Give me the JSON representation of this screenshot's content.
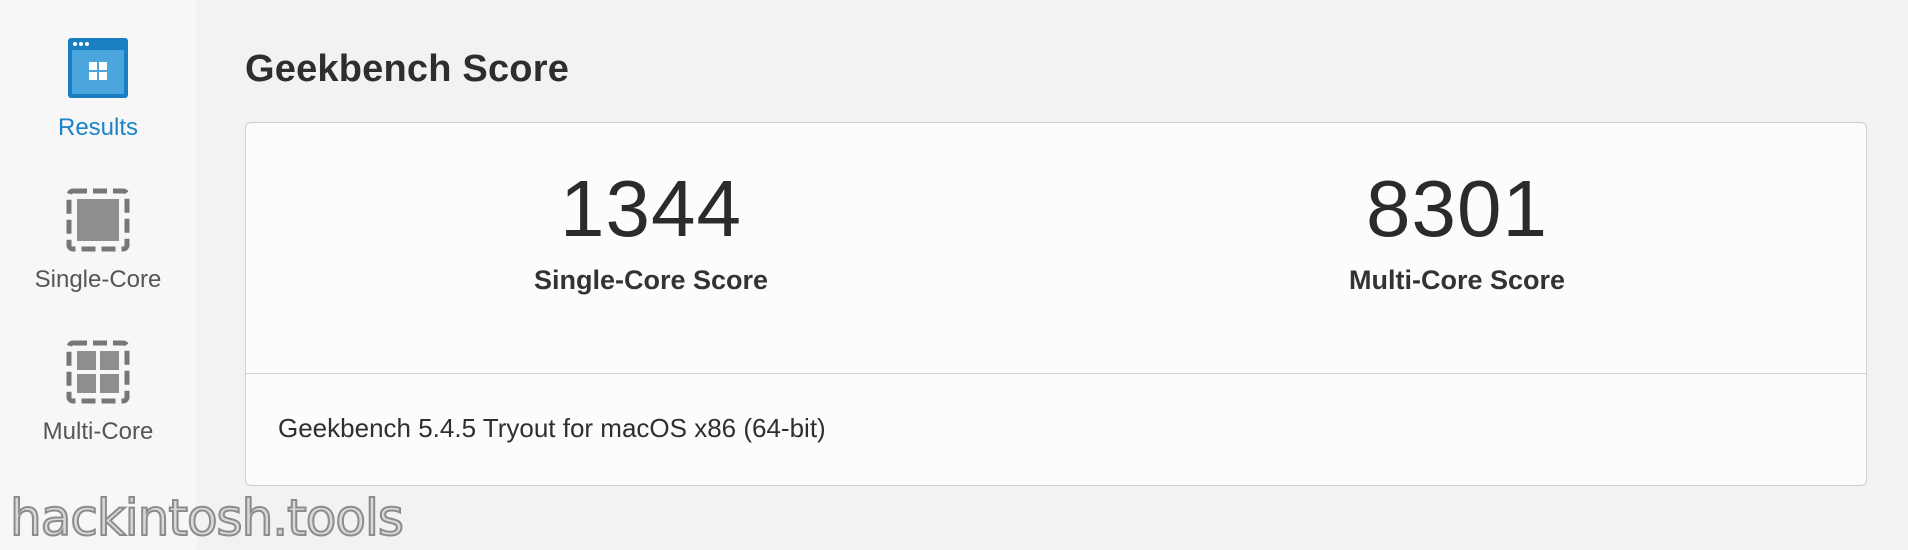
{
  "sidebar": {
    "items": [
      {
        "label": "Results",
        "icon": "results-icon",
        "active": true
      },
      {
        "label": "Single-Core",
        "icon": "single-core-icon",
        "active": false
      },
      {
        "label": "Multi-Core",
        "icon": "multi-core-icon",
        "active": false
      }
    ]
  },
  "main": {
    "title": "Geekbench Score",
    "single_core": {
      "value": "1344",
      "label": "Single-Core Score"
    },
    "multi_core": {
      "value": "8301",
      "label": "Multi-Core Score"
    },
    "version": "Geekbench 5.4.5 Tryout for macOS x86 (64-bit)"
  },
  "watermark": "hackintosh.tools",
  "colors": {
    "accent": "#1a84c7",
    "background": "#f2f2f2",
    "sidebar": "#f7f7f7",
    "card": "#fcfcfc"
  }
}
